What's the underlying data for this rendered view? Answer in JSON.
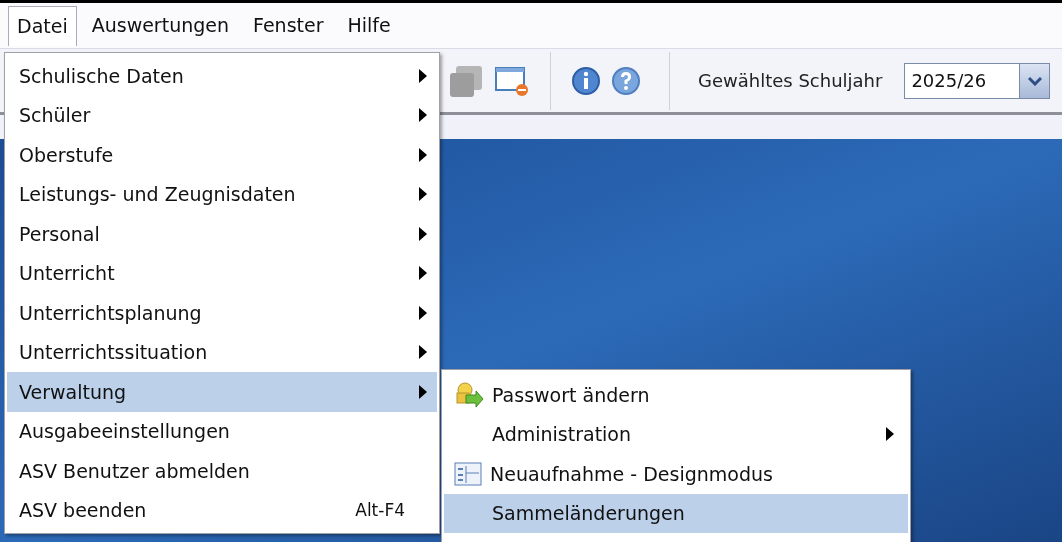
{
  "menubar": [
    {
      "label": "Datei",
      "selected": true
    },
    {
      "label": "Auswertungen",
      "selected": false
    },
    {
      "label": "Fenster",
      "selected": false
    },
    {
      "label": "Hilfe",
      "selected": false
    }
  ],
  "toolbar": {
    "year_label": "Gewähltes Schuljahr",
    "year_value": "2025/26"
  },
  "file_menu": [
    {
      "label": "Schulische Daten",
      "kind": "submenu",
      "selected": false
    },
    {
      "label": "Schüler",
      "kind": "submenu",
      "selected": false
    },
    {
      "label": "Oberstufe",
      "kind": "submenu",
      "selected": false
    },
    {
      "label": "Leistungs- und Zeugnisdaten",
      "kind": "submenu",
      "selected": false
    },
    {
      "label": "Personal",
      "kind": "submenu",
      "selected": false
    },
    {
      "label": "Unterricht",
      "kind": "submenu",
      "selected": false
    },
    {
      "label": "Unterrichtsplanung",
      "kind": "submenu",
      "selected": false
    },
    {
      "label": "Unterrichtssituation",
      "kind": "submenu",
      "selected": false
    },
    {
      "label": "Verwaltung",
      "kind": "submenu",
      "selected": true
    },
    {
      "label": "Ausgabeeinstellungen",
      "kind": "action",
      "selected": false
    },
    {
      "label": "ASV Benutzer abmelden",
      "kind": "action",
      "selected": false
    },
    {
      "label": "ASV beenden",
      "kind": "action",
      "shortcut": "Alt-F4",
      "selected": false
    }
  ],
  "verwaltung_submenu": [
    {
      "label": "Passwort ändern",
      "kind": "keys",
      "selected": false
    },
    {
      "label": "Administration",
      "kind": "submenu",
      "selected": false
    },
    {
      "label": "Neuaufnahme - Designmodus",
      "kind": "form",
      "selected": false
    },
    {
      "label": "Sammeländerungen",
      "kind": "action",
      "selected": true
    }
  ]
}
